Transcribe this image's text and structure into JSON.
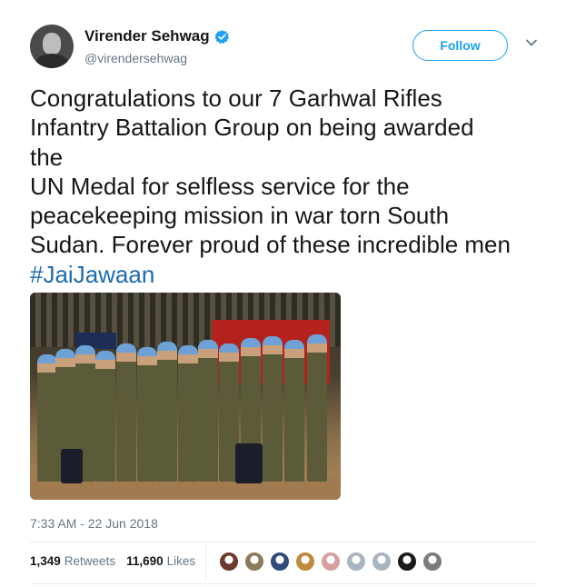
{
  "author": {
    "name": "Virender Sehwag",
    "handle": "@virendersehwag",
    "verified": true
  },
  "follow_label": "Follow",
  "tweet": {
    "lines": [
      "Congratulations to our 7 Garhwal Rifles",
      "Infantry Battalion Group on being awarded",
      "the",
      "UN Medal for selfless service for the",
      "peacekeeping mission in war torn South",
      "Sudan. Forever proud of these incredible men"
    ],
    "hashtag": "#JaiJawaan"
  },
  "timestamp": "7:33 AM - 22 Jun 2018",
  "stats": {
    "retweets": "1,349",
    "retweets_label": "Retweets",
    "likes": "11,690",
    "likes_label": "Likes"
  },
  "colors": {
    "accent": "#1da1f2",
    "verified": "#1da1f2",
    "hashtag": "#1b6bb0",
    "secondary_text": "#657786"
  },
  "liker_avatars": [
    {
      "color": "#6b3b2e"
    },
    {
      "color": "#8c7a5c"
    },
    {
      "color": "#2f4c7a"
    },
    {
      "color": "#c08a3c"
    },
    {
      "color": "#d4a0a0"
    },
    {
      "color": "#a8b4bf"
    },
    {
      "color": "#a8b4bf"
    },
    {
      "color": "#1a1a1a"
    },
    {
      "color": "#7c7c7c"
    }
  ]
}
